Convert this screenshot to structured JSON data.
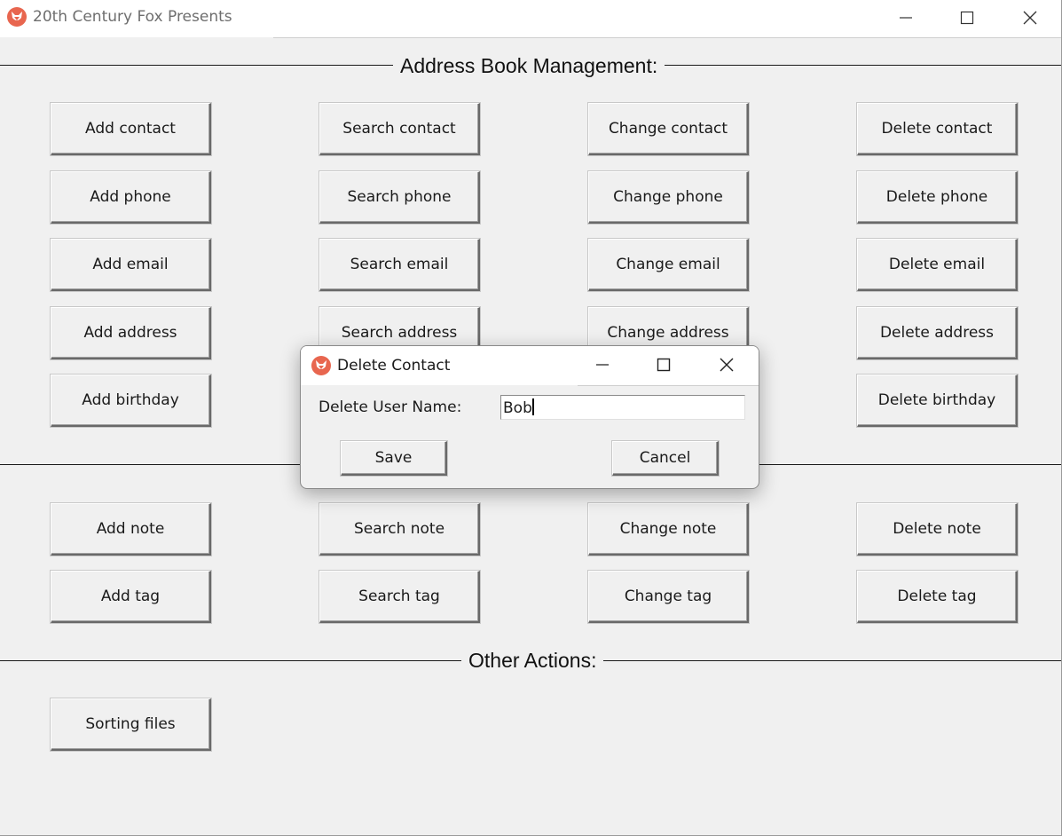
{
  "window": {
    "title": "20th Century Fox Presents",
    "icon": "fox-icon"
  },
  "sections": {
    "address_book": "Address Book Management:",
    "other_actions": "Other Actions:"
  },
  "buttons": {
    "add_contact": "Add contact",
    "search_contact": "Search contact",
    "change_contact": "Change contact",
    "delete_contact": "Delete contact",
    "add_phone": "Add phone",
    "search_phone": "Search phone",
    "change_phone": "Change phone",
    "delete_phone": "Delete phone",
    "add_email": "Add email",
    "search_email": "Search email",
    "change_email": "Change email",
    "delete_email": "Delete email",
    "add_address": "Add address",
    "search_address": "Search address",
    "change_address": "Change address",
    "delete_address": "Delete address",
    "add_birthday": "Add birthday",
    "delete_birthday": "Delete birthday",
    "add_note": "Add note",
    "search_note": "Search note",
    "change_note": "Change note",
    "delete_note": "Delete note",
    "add_tag": "Add tag",
    "search_tag": "Search tag",
    "change_tag": "Change tag",
    "delete_tag": "Delete tag",
    "sorting_files": "Sorting files"
  },
  "dialog": {
    "title": "Delete Contact",
    "field_label": "Delete User Name:",
    "field_value": "Bob",
    "save_label": "Save",
    "cancel_label": "Cancel"
  },
  "colors": {
    "icon_accent": "#e8664f",
    "background": "#f0f0f0"
  }
}
